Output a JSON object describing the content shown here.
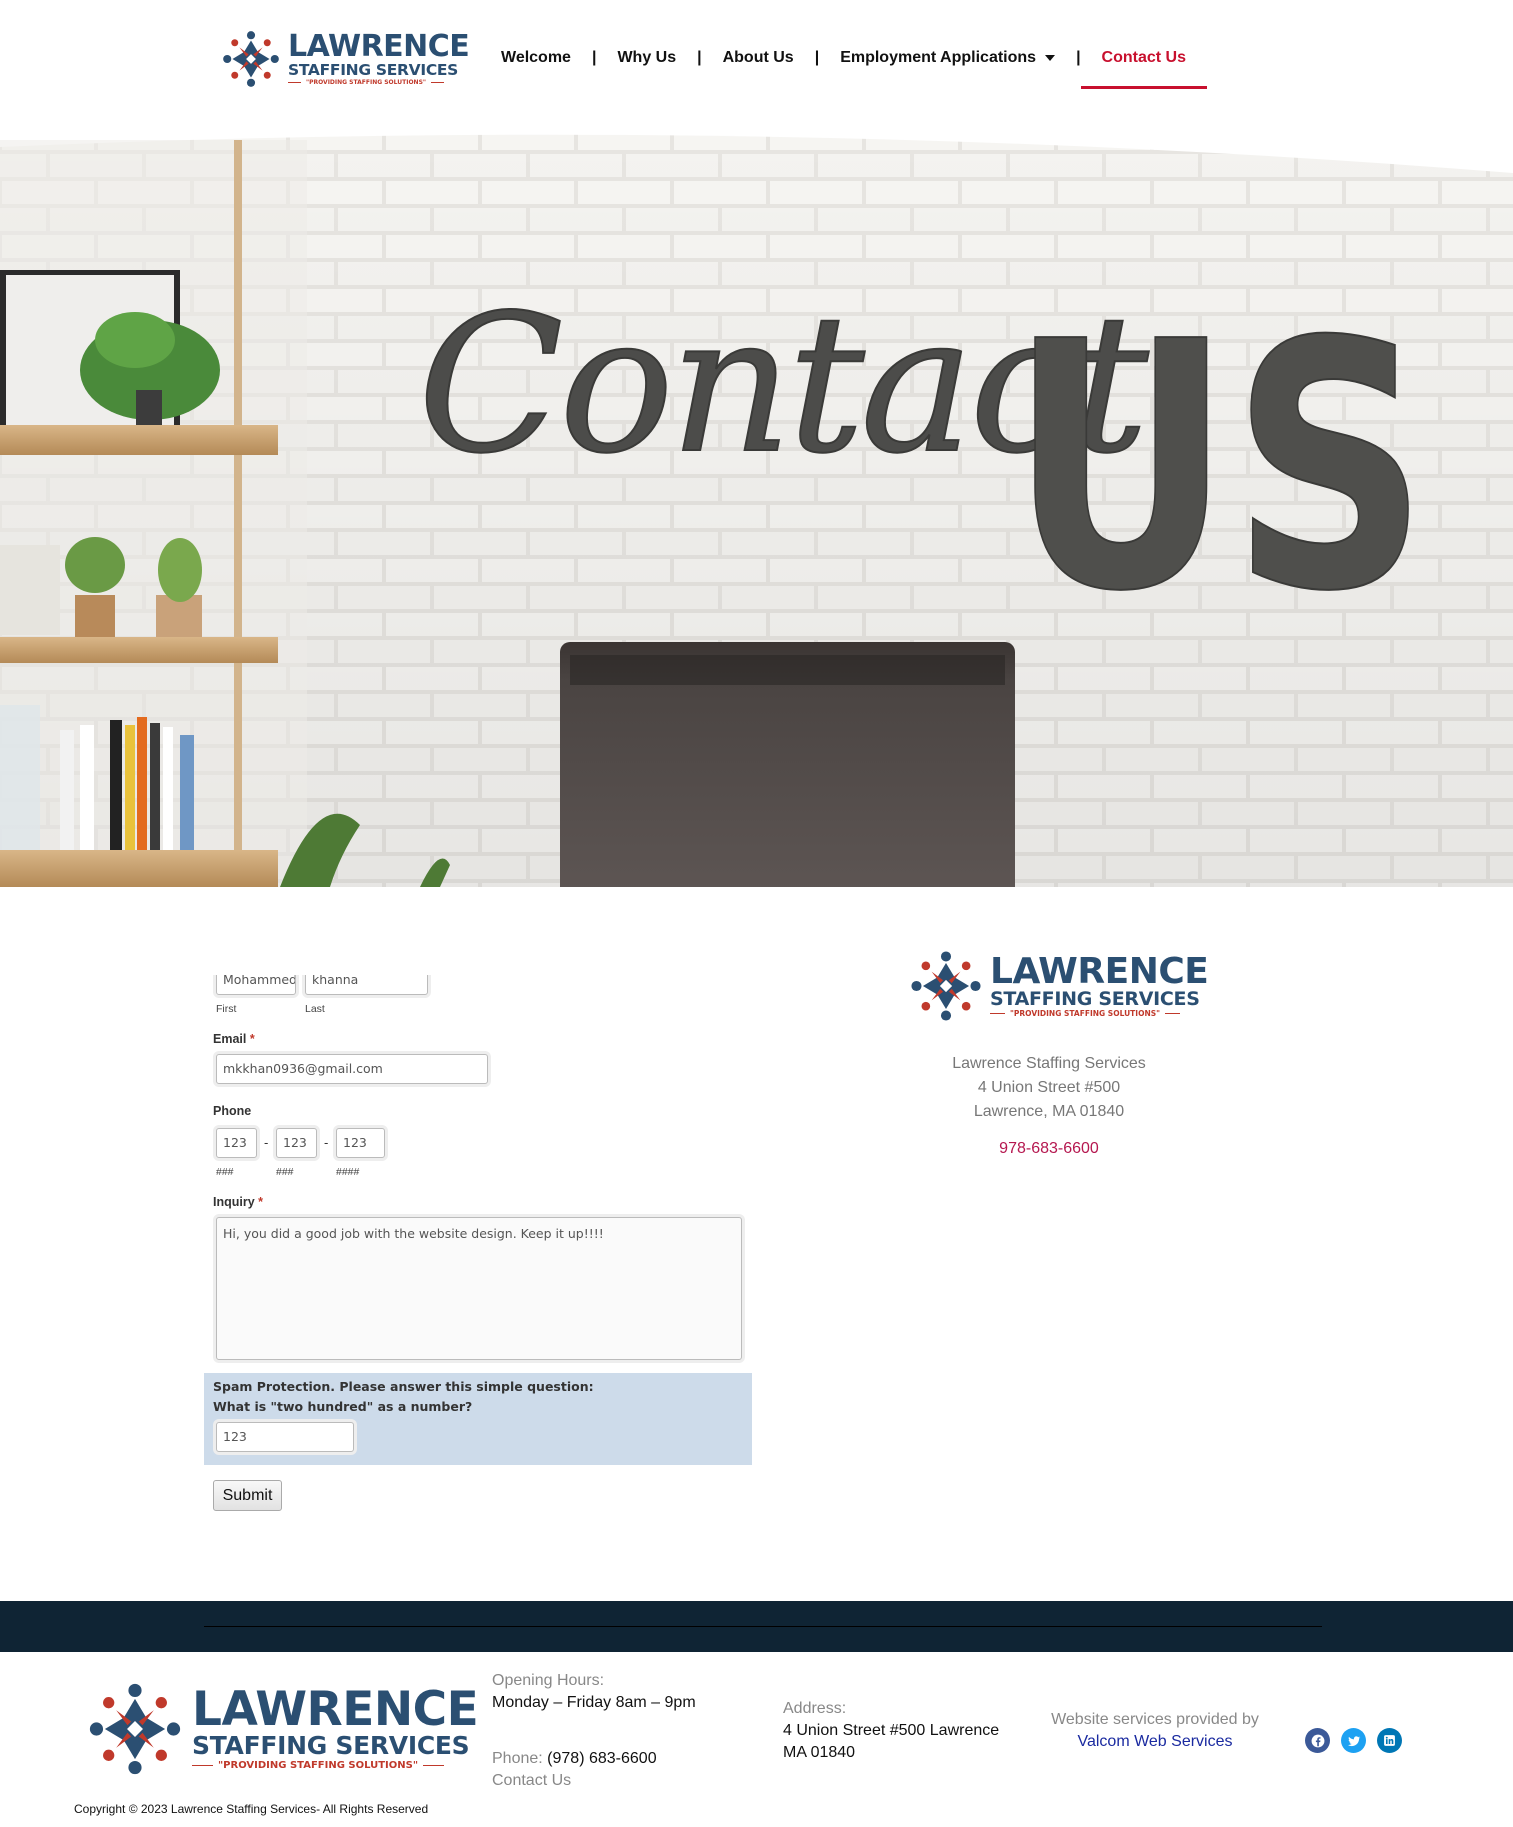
{
  "brand": {
    "name_line1": "LAWRENCE",
    "name_line2": "STAFFING SERVICES",
    "tagline": "\"PROVIDING STAFFING SOLUTIONS\"",
    "colors": {
      "navy": "#2b4f72",
      "red": "#c0392b"
    }
  },
  "nav": {
    "items": [
      {
        "label": "Welcome"
      },
      {
        "label": "Why Us"
      },
      {
        "label": "About Us"
      },
      {
        "label": "Employment Applications",
        "has_dropdown": true
      },
      {
        "label": "Contact Us",
        "active": true
      }
    ],
    "separator": "|",
    "active_color": "#c8102e"
  },
  "hero": {
    "sign_script": "Contact",
    "sign_block": "US"
  },
  "form": {
    "name": {
      "first_value": "Mohammed",
      "last_value": "khanna",
      "first_label": "First",
      "last_label": "Last"
    },
    "email": {
      "label": "Email",
      "required_mark": "*",
      "value": "mkkhan0936@gmail.com"
    },
    "phone": {
      "label": "Phone",
      "part1": "123",
      "part2": "123",
      "part3": "123",
      "hint1": "###",
      "hint2": "###",
      "hint3": "####",
      "dash": "-"
    },
    "inquiry": {
      "label": "Inquiry",
      "required_mark": "*",
      "value": "Hi, you did a good job with the website design. Keep it up!!!!"
    },
    "spam": {
      "line1": "Spam Protection. Please answer this simple question:",
      "line2": "What is \"two hundred\" as a number?",
      "value": "123"
    },
    "submit_label": "Submit"
  },
  "contact": {
    "company": "Lawrence Staffing Services",
    "street": "4 Union Street #500",
    "city": "Lawrence, MA 01840",
    "phone": "978-683-6600"
  },
  "footer": {
    "hours_label": "Opening Hours:",
    "hours_value": "Monday – Friday 8am – 9pm",
    "phone_label": "Phone:",
    "phone_value": "(978) 683-6600",
    "contact_link": "Contact Us",
    "address_label": "Address:",
    "address_line1": "4 Union Street #500 Lawrence",
    "address_line2": "MA 01840",
    "credit_text": "Website services provided by",
    "credit_link": "Valcom Web Services",
    "copyright": "Copyright © 2023 Lawrence Staffing Services- All Rights Reserved",
    "social": [
      {
        "icon": "facebook-icon",
        "color": "#3b5998"
      },
      {
        "icon": "twitter-icon",
        "color": "#1da1f2"
      },
      {
        "icon": "linkedin-icon",
        "color": "#0077b5"
      }
    ]
  }
}
